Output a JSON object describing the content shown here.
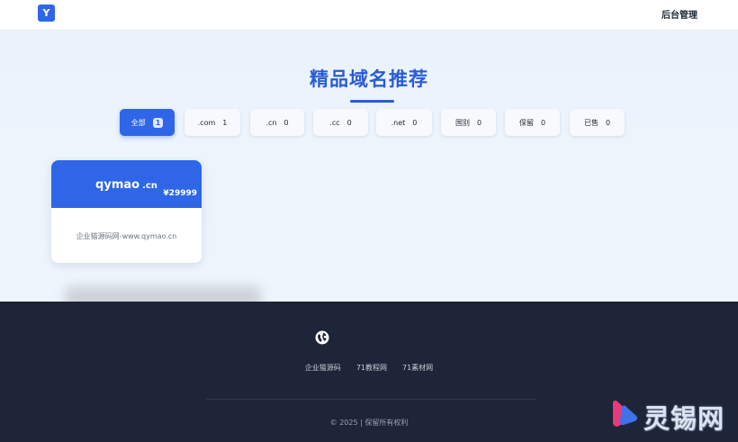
{
  "header": {
    "logo_letter": "Y",
    "admin_label": "后台管理"
  },
  "main": {
    "title": "精品域名推荐",
    "filters": [
      {
        "label": "全部",
        "count": "1",
        "active": true
      },
      {
        "label": ".com",
        "count": "1",
        "active": false
      },
      {
        "label": ".cn",
        "count": "0",
        "active": false
      },
      {
        "label": ".cc",
        "count": "0",
        "active": false
      },
      {
        "label": ".net",
        "count": "0",
        "active": false
      },
      {
        "label": "国别",
        "count": "0",
        "active": false
      },
      {
        "label": "保留",
        "count": "0",
        "active": false
      },
      {
        "label": "已售",
        "count": "0",
        "active": false
      }
    ],
    "domain_card": {
      "name": "qymao",
      "tld": ".cn",
      "price": "¥29999",
      "description": "企业猫源码网-www.qymao.cn"
    }
  },
  "footer": {
    "icon": "globe-icon",
    "links": [
      "企业猫源码",
      "71教程网",
      "71素材网"
    ],
    "copyright": "© 2025 | 保留所有权利"
  },
  "watermark": {
    "text": "灵锡网"
  },
  "colors": {
    "accent": "#2f66e8",
    "title": "#2a5bd7",
    "footer_bg": "#1e2538",
    "page_bg": "#eef5fc"
  }
}
